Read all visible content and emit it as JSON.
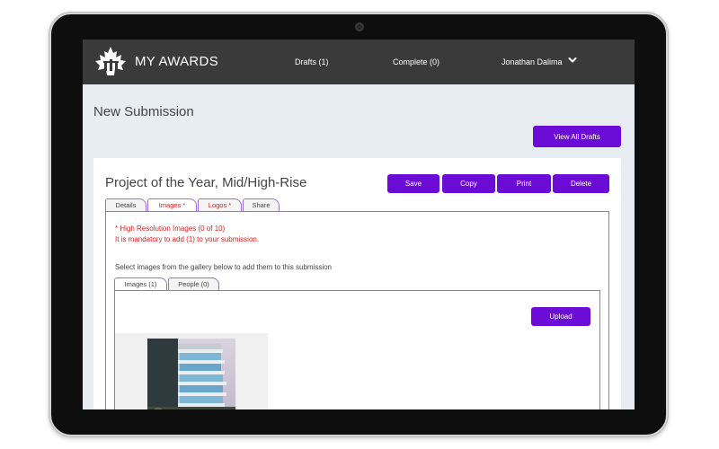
{
  "header": {
    "brand": "MY AWARDS",
    "nav": {
      "drafts": "Drafts (1)",
      "complete": "Complete (0)",
      "user": "Jonathan Dalima"
    },
    "icons": {
      "logo": "maple-leaf-logo",
      "user_menu": "chevron-down-icon"
    },
    "colors": {
      "bar": "#3a3a3a",
      "accent": "#6a0bd6"
    }
  },
  "page": {
    "title": "New Submission",
    "view_all_drafts": "View All Drafts"
  },
  "submission": {
    "title": "Project of the Year, Mid/High-Rise",
    "actions": {
      "save": "Save",
      "copy": "Copy",
      "print": "Print",
      "delete": "Delete"
    },
    "tabs": [
      {
        "label": "Details",
        "required": false,
        "active": false
      },
      {
        "label": "Images *",
        "required": true,
        "active": true
      },
      {
        "label": "Logos *",
        "required": true,
        "active": false
      },
      {
        "label": "Share",
        "required": false,
        "active": false
      }
    ],
    "images_panel": {
      "warning_line1": "* High Resolution Images (0 of 10)",
      "warning_line2": "It is mandatory to add (1) to your submission.",
      "hint": "Select images from the gallery below to add them to this submission",
      "gallery_tabs": [
        {
          "label": "Images (1)",
          "active": true
        },
        {
          "label": "People (0)",
          "active": false
        }
      ],
      "upload": "Upload"
    }
  }
}
